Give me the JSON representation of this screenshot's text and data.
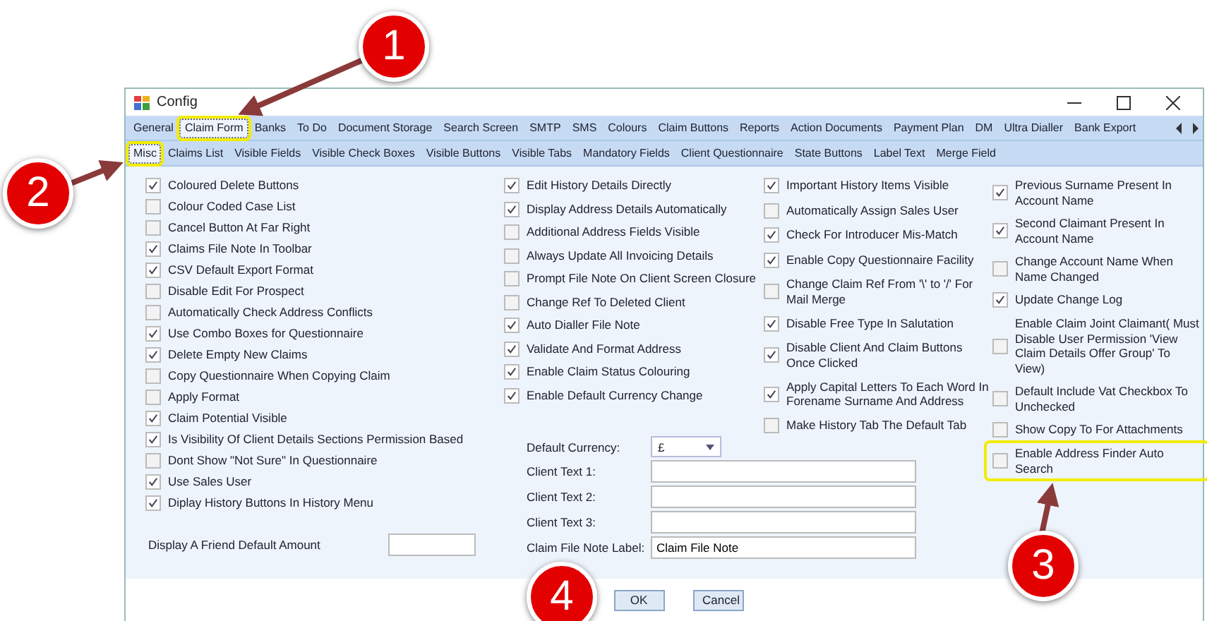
{
  "window": {
    "title": "Config"
  },
  "main_tabs": [
    {
      "label": "General",
      "selected": false,
      "highlighted": false
    },
    {
      "label": "Claim Form",
      "selected": true,
      "highlighted": true
    },
    {
      "label": "Banks",
      "selected": false,
      "highlighted": false
    },
    {
      "label": "To Do",
      "selected": false,
      "highlighted": false
    },
    {
      "label": "Document Storage",
      "selected": false,
      "highlighted": false
    },
    {
      "label": "Search Screen",
      "selected": false,
      "highlighted": false
    },
    {
      "label": "SMTP",
      "selected": false,
      "highlighted": false
    },
    {
      "label": "SMS",
      "selected": false,
      "highlighted": false
    },
    {
      "label": "Colours",
      "selected": false,
      "highlighted": false
    },
    {
      "label": "Claim Buttons",
      "selected": false,
      "highlighted": false
    },
    {
      "label": "Reports",
      "selected": false,
      "highlighted": false
    },
    {
      "label": "Action Documents",
      "selected": false,
      "highlighted": false
    },
    {
      "label": "Payment Plan",
      "selected": false,
      "highlighted": false
    },
    {
      "label": "DM",
      "selected": false,
      "highlighted": false
    },
    {
      "label": "Ultra Dialler",
      "selected": false,
      "highlighted": false
    },
    {
      "label": "Bank Export",
      "selected": false,
      "highlighted": false
    }
  ],
  "sub_tabs": [
    {
      "label": "Misc",
      "selected": true,
      "highlighted": true
    },
    {
      "label": "Claims List",
      "selected": false,
      "highlighted": false
    },
    {
      "label": "Visible Fields",
      "selected": false,
      "highlighted": false
    },
    {
      "label": "Visible Check Boxes",
      "selected": false,
      "highlighted": false
    },
    {
      "label": "Visible Buttons",
      "selected": false,
      "highlighted": false
    },
    {
      "label": "Visible Tabs",
      "selected": false,
      "highlighted": false
    },
    {
      "label": "Mandatory Fields",
      "selected": false,
      "highlighted": false
    },
    {
      "label": "Client Questionnaire",
      "selected": false,
      "highlighted": false
    },
    {
      "label": "State Buttons",
      "selected": false,
      "highlighted": false
    },
    {
      "label": "Label Text",
      "selected": false,
      "highlighted": false
    },
    {
      "label": "Merge Field",
      "selected": false,
      "highlighted": false
    }
  ],
  "columns": [
    [
      {
        "label": "Coloured Delete Buttons",
        "checked": true,
        "highlighted": false
      },
      {
        "label": "Colour Coded Case List",
        "checked": false,
        "highlighted": false
      },
      {
        "label": "Cancel Button At Far Right",
        "checked": false,
        "highlighted": false
      },
      {
        "label": "Claims File Note In Toolbar",
        "checked": true,
        "highlighted": false
      },
      {
        "label": "CSV Default Export Format",
        "checked": true,
        "highlighted": false
      },
      {
        "label": "Disable Edit For Prospect",
        "checked": false,
        "highlighted": false
      },
      {
        "label": "Automatically Check Address Conflicts",
        "checked": false,
        "highlighted": false
      },
      {
        "label": "Use Combo Boxes for Questionnaire",
        "checked": true,
        "highlighted": false
      },
      {
        "label": "Delete Empty New Claims",
        "checked": true,
        "highlighted": false
      },
      {
        "label": "Copy Questionnaire When Copying Claim",
        "checked": false,
        "highlighted": false
      },
      {
        "label": "Apply Format",
        "checked": false,
        "highlighted": false
      },
      {
        "label": "Claim Potential Visible",
        "checked": true,
        "highlighted": false
      },
      {
        "label": "Is Visibility Of Client Details Sections Permission Based",
        "checked": true,
        "highlighted": false
      },
      {
        "label": "Dont Show \"Not Sure\" In Questionnaire",
        "checked": false,
        "highlighted": false
      },
      {
        "label": "Use Sales User",
        "checked": true,
        "highlighted": false
      },
      {
        "label": "Diplay History Buttons In History Menu",
        "checked": true,
        "highlighted": false
      }
    ],
    [
      {
        "label": "Edit History Details Directly",
        "checked": true,
        "highlighted": false
      },
      {
        "label": "Display Address Details Automatically",
        "checked": true,
        "highlighted": false
      },
      {
        "label": "Additional Address Fields Visible",
        "checked": false,
        "highlighted": false
      },
      {
        "label": "Always Update All Invoicing Details",
        "checked": false,
        "highlighted": false
      },
      {
        "label": "Prompt File Note On Client Screen Closure",
        "checked": false,
        "highlighted": false
      },
      {
        "label": "Change Ref To Deleted Client",
        "checked": false,
        "highlighted": false
      },
      {
        "label": "Auto Dialler File Note",
        "checked": true,
        "highlighted": false
      },
      {
        "label": "Validate And Format Address",
        "checked": true,
        "highlighted": false
      },
      {
        "label": "Enable Claim Status Colouring",
        "checked": true,
        "highlighted": false
      },
      {
        "label": "Enable Default Currency Change",
        "checked": true,
        "highlighted": false
      }
    ],
    [
      {
        "label": "Important History Items Visible",
        "checked": true,
        "highlighted": false
      },
      {
        "label": "Automatically Assign Sales User",
        "checked": false,
        "highlighted": false
      },
      {
        "label": "Check For Introducer Mis-Match",
        "checked": true,
        "highlighted": false
      },
      {
        "label": "Enable Copy Questionnaire Facility",
        "checked": true,
        "highlighted": false
      },
      {
        "label": "Change Claim Ref  From '\\' to '/' For Mail Merge",
        "checked": false,
        "highlighted": false
      },
      {
        "label": "Disable Free Type In Salutation",
        "checked": true,
        "highlighted": false
      },
      {
        "label": "Disable Client And Claim Buttons Once Clicked",
        "checked": true,
        "highlighted": false
      },
      {
        "label": "Apply Capital Letters To Each Word In Forename Surname And Address",
        "checked": true,
        "highlighted": false
      },
      {
        "label": "Make History Tab The Default Tab",
        "checked": false,
        "highlighted": false
      }
    ],
    [
      {
        "label": "Previous Surname Present In Account Name",
        "checked": true,
        "highlighted": false
      },
      {
        "label": "Second Claimant Present In Account Name",
        "checked": true,
        "highlighted": false
      },
      {
        "label": "Change Account Name When Name Changed",
        "checked": false,
        "highlighted": false
      },
      {
        "label": "Update Change Log",
        "checked": true,
        "highlighted": false
      },
      {
        "label": "Enable Claim Joint Claimant( Must Disable User Permission 'View Claim Details Offer Group' To View)",
        "checked": false,
        "highlighted": false
      },
      {
        "label": "Default Include Vat Checkbox To Unchecked",
        "checked": false,
        "highlighted": false
      },
      {
        "label": "Show Copy To For Attachments",
        "checked": false,
        "highlighted": false
      },
      {
        "label": "Enable Address Finder Auto Search",
        "checked": false,
        "highlighted": true
      }
    ]
  ],
  "friend_amount": {
    "label": "Display A Friend Default Amount"
  },
  "form_fields": [
    {
      "kind": "dropdown",
      "label": "Default Currency:",
      "value": "£"
    },
    {
      "kind": "text",
      "label": "Client Text 1:"
    },
    {
      "kind": "text",
      "label": "Client Text 2:"
    },
    {
      "kind": "text",
      "label": "Client Text 3:"
    },
    {
      "kind": "text",
      "label": "Claim File Note Label:",
      "value": "Claim File Note"
    }
  ],
  "buttons": [
    "OK",
    "Cancel"
  ],
  "callouts": [
    {
      "number": "1"
    },
    {
      "number": "2"
    },
    {
      "number": "3"
    },
    {
      "number": "4"
    }
  ]
}
